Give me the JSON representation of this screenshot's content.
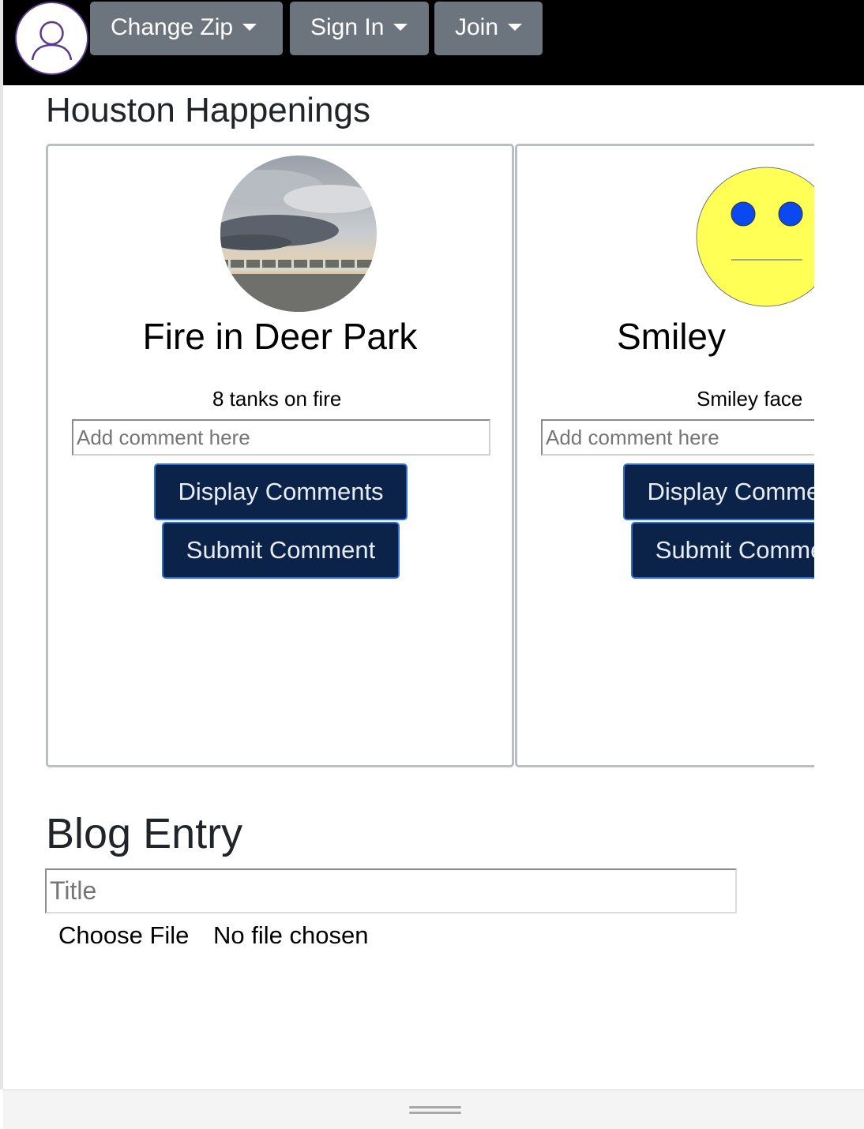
{
  "navbar": {
    "change_zip": "Change Zip",
    "sign_in": "Sign In",
    "join": "Join"
  },
  "happenings": {
    "title": "Houston Happenings",
    "cards": [
      {
        "title": "Fire in Deer Park",
        "description": "8 tanks on fire",
        "comment_placeholder": "Add comment here",
        "display_button": "Display Comments",
        "submit_button": "Submit Comment"
      },
      {
        "title": "Smiley",
        "description": "Smiley face",
        "comment_placeholder": "Add comment here",
        "display_button": "Display Comments",
        "submit_button": "Submit Comment"
      }
    ]
  },
  "blog": {
    "title": "Blog Entry",
    "title_placeholder": "Title",
    "choose_file": "Choose File",
    "no_file": "No file chosen"
  },
  "colors": {
    "navbar_bg": "#000000",
    "nav_button": "#6c757d",
    "card_button": "#0b2249",
    "card_button_border": "#2f6fd8"
  },
  "icons": [
    "user-avatar-icon",
    "dropdown-caret-icon",
    "resize-grip-icon"
  ]
}
